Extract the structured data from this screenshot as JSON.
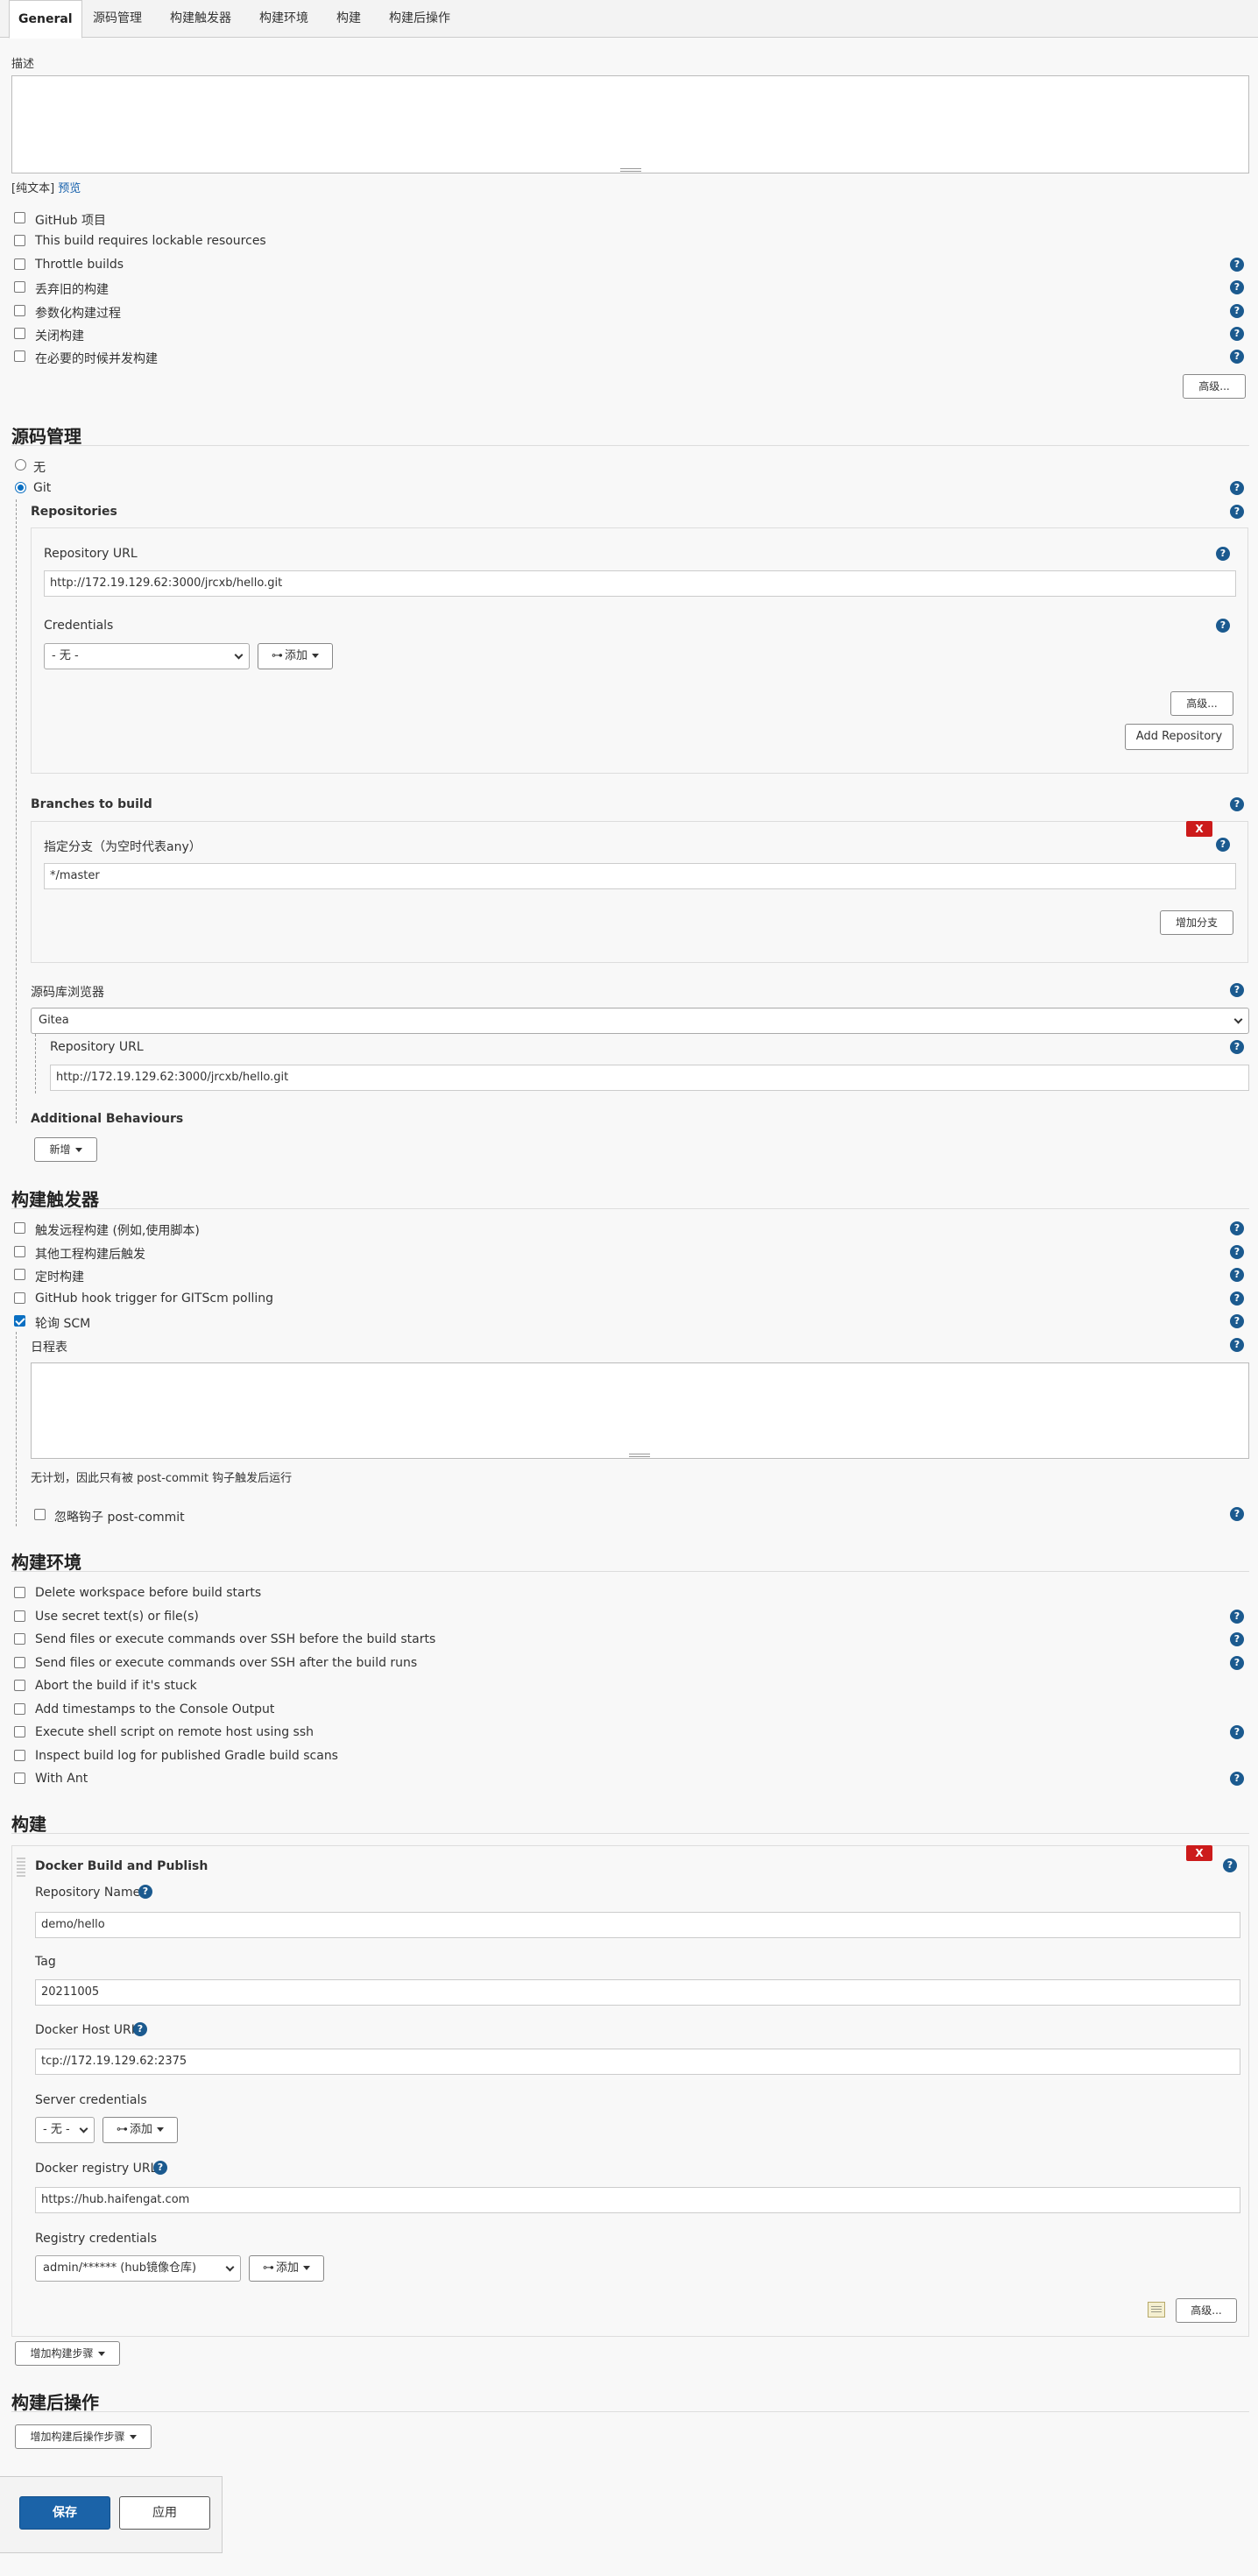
{
  "tabs": [
    {
      "label": "General",
      "active": true
    },
    {
      "label": "源码管理"
    },
    {
      "label": "构建触发器"
    },
    {
      "label": "构建环境"
    },
    {
      "label": "构建"
    },
    {
      "label": "构建后操作"
    }
  ],
  "general": {
    "description_label": "描述",
    "plain_text": "[纯文本]",
    "preview": "预览",
    "options": [
      {
        "label": "GitHub 项目",
        "checked": false
      },
      {
        "label": "This build requires lockable resources",
        "checked": false
      },
      {
        "label": "Throttle builds",
        "checked": false
      },
      {
        "label": "丢弃旧的构建",
        "checked": false
      },
      {
        "label": "参数化构建过程",
        "checked": false
      },
      {
        "label": "关闭构建",
        "checked": false
      },
      {
        "label": "在必要的时候并发构建",
        "checked": false
      }
    ],
    "advanced_button": "高级..."
  },
  "scm": {
    "title": "源码管理",
    "none_label": "无",
    "git_label": "Git",
    "repositories_label": "Repositories",
    "repo_url_label": "Repository URL",
    "repo_url_value": "http://172.19.129.62:3000/jrcxb/hello.git",
    "credentials_label": "Credentials",
    "credentials_value": "- 无 -",
    "add_label": "添加",
    "advanced_button": "高级...",
    "add_repository_button": "Add Repository",
    "branches_label": "Branches to build",
    "x_label": "X",
    "branch_spec_label": "指定分支（为空时代表any）",
    "branch_spec_value": "*/master",
    "add_branch_button": "增加分支",
    "browser_label": "源码库浏览器",
    "browser_value": "Gitea",
    "browser_repo_url_label": "Repository URL",
    "browser_repo_url_value": "http://172.19.129.62:3000/jrcxb/hello.git",
    "additional_behaviours_label": "Additional Behaviours",
    "new_button": "新增"
  },
  "triggers": {
    "title": "构建触发器",
    "options": [
      {
        "label": "触发远程构建 (例如,使用脚本)",
        "checked": false
      },
      {
        "label": "其他工程构建后触发",
        "checked": false
      },
      {
        "label": "定时构建",
        "checked": false
      },
      {
        "label": "GitHub hook trigger for GITScm polling",
        "checked": false
      },
      {
        "label": "轮询 SCM",
        "checked": true
      }
    ],
    "schedule_label": "日程表",
    "schedule_note": "无计划，因此只有被 post-commit 钩子触发后运行",
    "ignore_hook_label": "忽略钩子 post-commit"
  },
  "environment": {
    "title": "构建环境",
    "options": [
      {
        "label": "Delete workspace before build starts",
        "checked": false
      },
      {
        "label": "Use secret text(s) or file(s)",
        "checked": false
      },
      {
        "label": "Send files or execute commands over SSH before the build starts",
        "checked": false
      },
      {
        "label": "Send files or execute commands over SSH after the build runs",
        "checked": false
      },
      {
        "label": "Abort the build if it's stuck",
        "checked": false
      },
      {
        "label": "Add timestamps to the Console Output",
        "checked": false
      },
      {
        "label": "Execute shell script on remote host using ssh",
        "checked": false
      },
      {
        "label": "Inspect build log for published Gradle build scans",
        "checked": false
      },
      {
        "label": "With Ant",
        "checked": false
      }
    ]
  },
  "build": {
    "title": "构建",
    "step_title": "Docker Build and Publish",
    "x_label": "X",
    "repo_name_label": "Repository Name",
    "repo_name_value": "demo/hello",
    "tag_label": "Tag",
    "tag_value": "20211005",
    "docker_host_label": "Docker Host URI",
    "docker_host_value": "tcp://172.19.129.62:2375",
    "server_credentials_label": "Server credentials",
    "server_credentials_value": "- 无 -",
    "add_label": "添加",
    "registry_url_label": "Docker registry URL",
    "registry_url_value": "https://hub.haifengat.com",
    "registry_credentials_label": "Registry credentials",
    "registry_credentials_value": "admin/****** (hub镜像仓库)",
    "advanced_button": "高级...",
    "add_step_button": "增加构建步骤"
  },
  "post_build": {
    "title": "构建后操作",
    "add_step_button": "增加构建后操作步骤"
  },
  "footer": {
    "save_button": "保存",
    "apply_button": "应用"
  },
  "colors": {
    "primary": "#1b63a8",
    "help_icon": "#1b5a8f",
    "delete": "#cc1b1b",
    "link": "#1761ac"
  }
}
